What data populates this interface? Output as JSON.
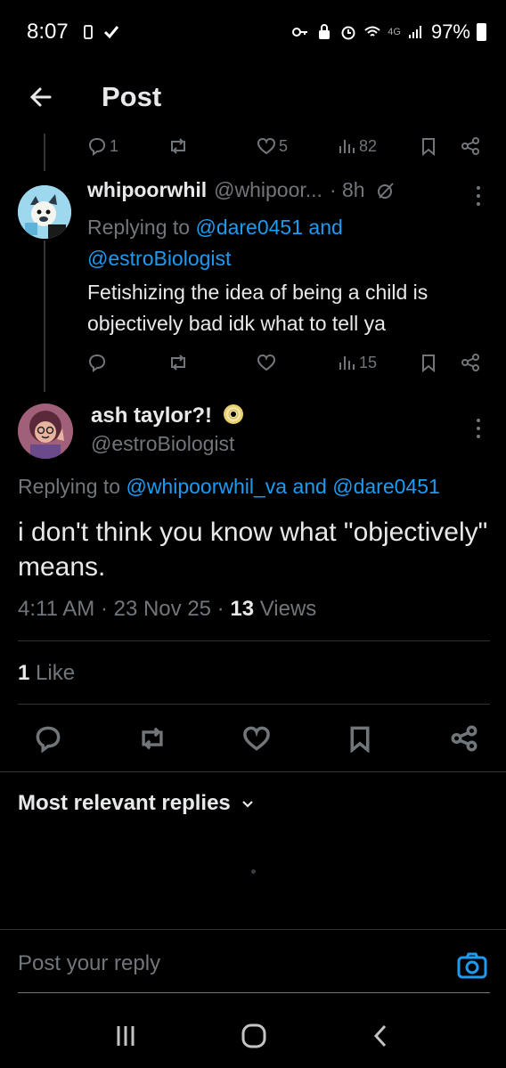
{
  "status_bar": {
    "time": "8:07",
    "network": "4G",
    "battery": "97%"
  },
  "header": {
    "title": "Post"
  },
  "prev_tweet_actions": {
    "replies": "1",
    "likes": "5",
    "views": "82"
  },
  "reply_tweet": {
    "name": "whipoorwhil",
    "handle": "@whipoor...",
    "time": "· 8h",
    "replying_prefix": "Replying to",
    "replying_to_1": "@dare0451",
    "replying_and": "and",
    "replying_to_2": "@estroBiologist",
    "text": "Fetishizing the idea of being a child is objectively bad idk what to tell ya",
    "views": "15"
  },
  "main_tweet": {
    "name": "ash taylor?!",
    "handle": "@estroBiologist",
    "replying_prefix": "Replying to",
    "replying_to_1": "@whipoorwhil_va",
    "replying_and": "and",
    "replying_to_2": "@dare0451",
    "text": "i don't think you know what \"objectively\" means.",
    "time": "4:11 AM",
    "date": "23 Nov 25",
    "views_count": "13",
    "views_label": "Views",
    "likes_count": "1",
    "likes_label": "Like"
  },
  "replies_sort": {
    "label": "Most relevant replies"
  },
  "reply_box": {
    "placeholder": "Post your reply"
  },
  "colors": {
    "accent": "#1d9bf0",
    "muted": "#71767b",
    "text": "#e7e9ea",
    "background": "#000000"
  }
}
